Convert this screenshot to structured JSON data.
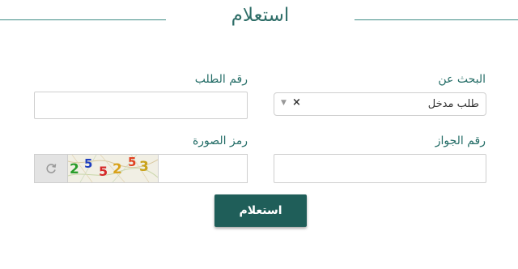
{
  "header": {
    "title": "استعلام"
  },
  "form": {
    "search_by": {
      "label": "البحث عن",
      "selected": "طلب مدخل",
      "clear_glyph": "×",
      "arrow_glyph": "▼"
    },
    "request_number": {
      "label": "رقم الطلب",
      "value": ""
    },
    "passport_number": {
      "label": "رقم الجواز",
      "value": ""
    },
    "captcha": {
      "label": "رمز الصورة",
      "value": "",
      "image_digits": [
        "2",
        "5",
        "5",
        "2",
        "5",
        "3"
      ],
      "digit_colors": [
        "#2a9d2a",
        "#1f3fbf",
        "#d62b2b",
        "#d9a21b",
        "#e04020",
        "#c9a21b"
      ]
    },
    "submit_label": "استعلام"
  },
  "colors": {
    "accent": "#1f5e59",
    "label": "#246d67",
    "rule": "#3f8c85"
  }
}
